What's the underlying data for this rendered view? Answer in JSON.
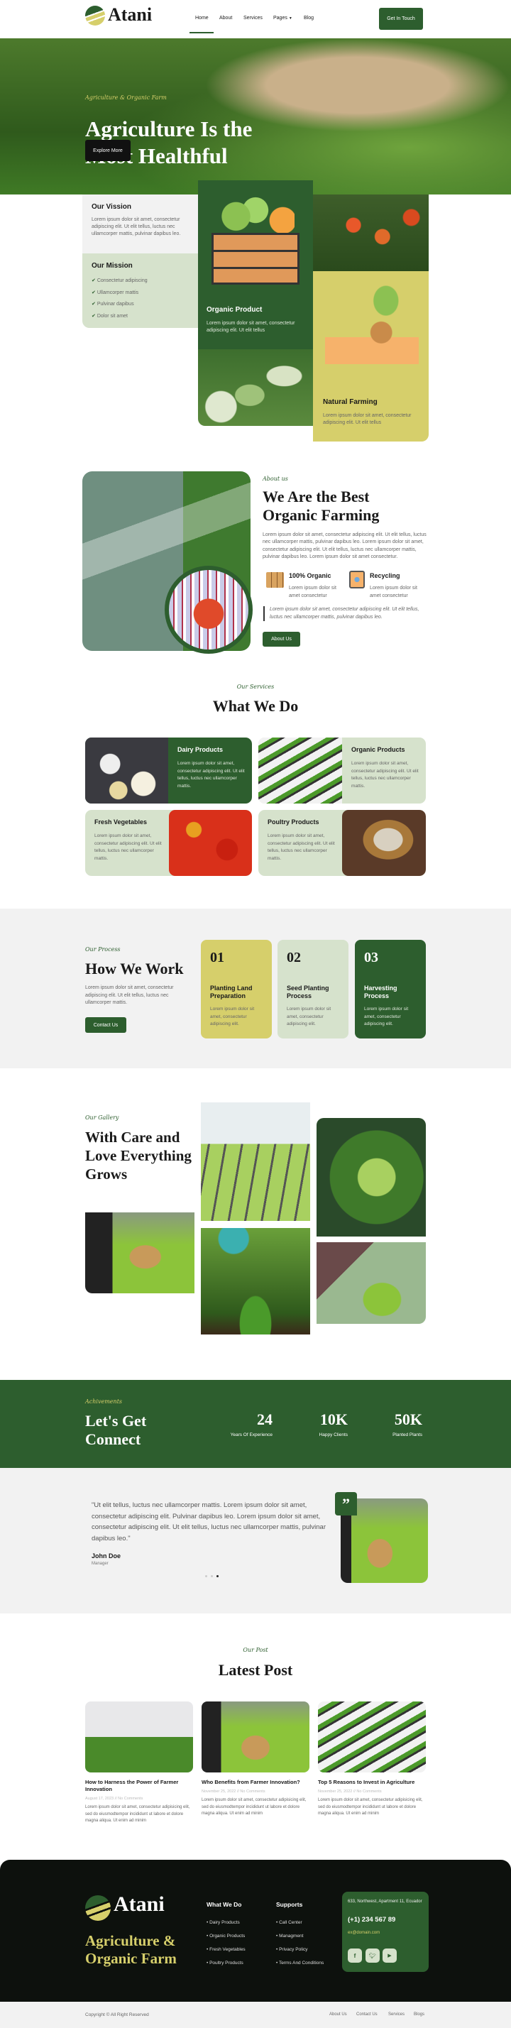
{
  "colors": {
    "primary": "#2d5e2e",
    "light": "#d6e2cc",
    "accent": "#d6cf6b",
    "footer": "#0d110d"
  },
  "nav": {
    "brand": "Atani",
    "items": [
      "Home",
      "About",
      "Services",
      "Pages",
      "Blog"
    ],
    "active": "Home",
    "cta": "Get In Touch"
  },
  "hero": {
    "eyebrow": "Agriculture & Organic Farm",
    "title_l1": "Agriculture Is the",
    "title_l2": "Most Healthful",
    "button": "Explore More"
  },
  "features": {
    "vision": {
      "title": "Our Vission",
      "text": "Lorem ipsum dolor sit amet, consectetur adipiscing elit. Ut elit tellus, luctus nec ullamcorper mattis, pulvinar dapibus leo."
    },
    "mission": {
      "title": "Our Mission",
      "items": [
        "Consectetur adipiscing",
        "Ullamcorper mattis",
        "Pulvinar dapibus",
        "Dolor sit amet"
      ]
    },
    "organic": {
      "title": "Organic Product",
      "text": "Lorem ipsum dolor sit amet, consectetur adipiscing elit. Ut elit tellus"
    },
    "natural": {
      "title": "Natural Farming",
      "text": "Lorem ipsum dolor sit amet, consectetur adipiscing elit. Ut elit tellus"
    }
  },
  "about": {
    "eyebrow": "About us",
    "title_l1": "We Are the Best",
    "title_l2": "Organic Farming",
    "text": "Lorem ipsum dolor sit amet, consectetur adipiscing elit. Ut elit tellus, luctus nec ullamcorper mattis, pulvinar dapibus leo. Lorem ipsum dolor sit amet, consectetur adipiscing elit. Ut elit tellus, luctus nec ullamcorper mattis, pulvinar dapibus leo. Lorem ipsum dolor sit amet consectetur.",
    "f1": {
      "title": "100% Organic",
      "text": "Lorem ipsum dolor sit amet consectetur"
    },
    "f2": {
      "title": "Recycling",
      "text": "Lorem ipsum dolor sit amet consectetur"
    },
    "quote": "Lorem ipsum dolor sit amet, consectetur adipiscing elit. Ut elit tellus, luctus nec ullamcorper mattis, pulvinar dapibus leo.",
    "button": "About Us"
  },
  "services": {
    "eyebrow": "Our Services",
    "title": "What We Do",
    "text": "Lorem ipsum dolor sit amet, consectetur adipiscing elit. Ut elit tellus, luctus nec ullamcorper mattis.",
    "items": [
      "Dairy Products",
      "Organic Products",
      "Fresh Vegetables",
      "Poultry Products"
    ]
  },
  "process": {
    "eyebrow": "Our Process",
    "title": "How We Work",
    "text": "Lorem ipsum dolor sit amet, consectetur adipiscing elit. Ut elit tellus, luctus nec ullamcorper mattis.",
    "button": "Contact Us",
    "card_text": "Lorem ipsum dolor sit amet, consectetur adipiscing elit.",
    "steps": [
      {
        "num": "01",
        "title": "Planting Land Preparation"
      },
      {
        "num": "02",
        "title": "Seed Planting Process"
      },
      {
        "num": "03",
        "title": "Harvesting Process"
      }
    ]
  },
  "gallery": {
    "eyebrow": "Our Gallery",
    "title": "With Care and Love Everything Grows"
  },
  "achievements": {
    "eyebrow": "Achivements",
    "title_l1": "Let's Get",
    "title_l2": "Connect",
    "stats": [
      {
        "value": "24",
        "label": "Years Of Experience"
      },
      {
        "value": "10K",
        "label": "Happy Clients"
      },
      {
        "value": "50K",
        "label": "Planted Plants"
      }
    ]
  },
  "testimonial": {
    "quote": "\"Ut elit tellus, luctus nec ullamcorper mattis. Lorem ipsum dolor sit amet, consectetur adipiscing elit. Pulvinar dapibus leo. Lorem ipsum dolor sit amet, consectetur adipiscing elit. Ut elit tellus, luctus nec ullamcorper mattis, pulvinar dapibus leo.\"",
    "name": "John Doe",
    "role": "Manager",
    "active_dot": 3
  },
  "posts": {
    "eyebrow": "Our Post",
    "title": "Latest Post",
    "text": "Lorem ipsum dolor sit amet, consectetur adipisicing elit, sed do eiusmodtempor incididunt ut labore et dolore magna aliqua. Ut enim ad minim",
    "items": [
      {
        "title": "How to Harness the Power of Farmer Innovation",
        "meta": "August 17, 2023 // No Comments"
      },
      {
        "title": "Who Benefits from Farmer Innovation?",
        "meta": "November 25, 2022 // No Comments"
      },
      {
        "title": "Top 5 Reasons to Invest in Agriculture",
        "meta": "November 25, 2022 // No Comments"
      }
    ]
  },
  "footer": {
    "brand": "Atani",
    "tagline_l1": "Agriculture &",
    "tagline_l2": "Organic Farm",
    "col1": {
      "title": "What We Do",
      "items": [
        "Dairy Products",
        "Organic Products",
        "Fresh Vegetables",
        "Poultry Products"
      ]
    },
    "col2": {
      "title": "Supports",
      "items": [
        "Call Center",
        "Managment",
        "Privacy Policy",
        "Terms And Conditions"
      ]
    },
    "address": "633, Northwest, Apartment 11, Ecuador",
    "phone": "(+1) 234 567 89",
    "email": "ex@domain.com",
    "social": [
      "facebook-icon",
      "twitter-icon",
      "youtube-icon"
    ],
    "copyright": "Copyright © All Right Reserved",
    "links": [
      "About Us",
      "Contact Us",
      "Services",
      "Blogs"
    ]
  }
}
